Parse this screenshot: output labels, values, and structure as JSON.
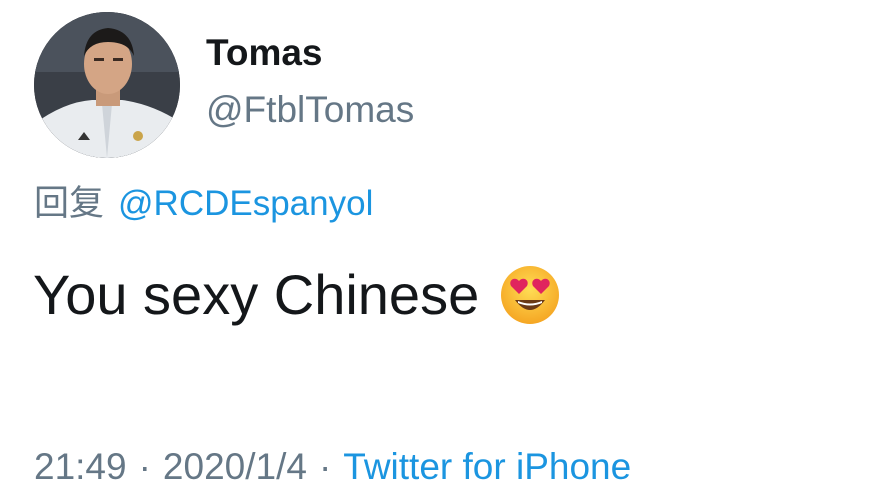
{
  "tweet": {
    "author": {
      "display_name": "Tomas",
      "handle": "@FtblTomas",
      "avatar_icon": "profile-photo"
    },
    "reply": {
      "prefix": "回复",
      "mention": "@RCDEspanyol"
    },
    "text": "You sexy Chinese",
    "emoji": "heart-eyes-emoji",
    "meta": {
      "time": "21:49",
      "separator": "·",
      "date": "2020/1/4",
      "source": "Twitter for iPhone"
    }
  },
  "colors": {
    "link": "#1b95e0",
    "secondary_text": "#657786",
    "primary_text": "#14171a",
    "background": "#ffffff"
  }
}
